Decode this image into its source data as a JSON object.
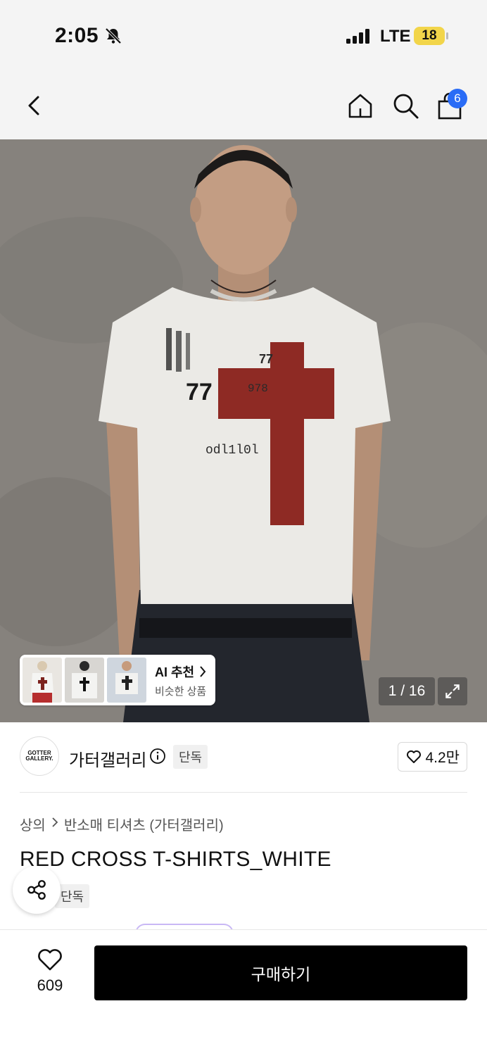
{
  "status_bar": {
    "time": "2:05",
    "network": "LTE",
    "battery": "18"
  },
  "header": {
    "cart_count": "6"
  },
  "gallery": {
    "ai_recommend_title": "AI 추천",
    "ai_recommend_subtitle": "비슷한 상품",
    "page_indicator": "1 / 16"
  },
  "brand": {
    "logo_text_line1": "GOTTER",
    "logo_text_line2": "GALLERY.",
    "name": "가터갤러리",
    "badge": "단독",
    "likes": "4.2만"
  },
  "breadcrumb": {
    "items": [
      "상의",
      "반소매 티셔츠 (가터갤러리)"
    ]
  },
  "product": {
    "title": "RED CROSS T-SHIRTS_WHITE",
    "badge": "단독"
  },
  "bottom_bar": {
    "wish_count": "609",
    "buy_label": "구매하기"
  },
  "colors": {
    "accent_badge": "#2a6cf6",
    "buy_button": "#000000",
    "battery": "#f2d54a",
    "shirt_cross": "#8e2a24"
  },
  "icons": [
    "bell-slash-icon",
    "signal-icon",
    "back-icon",
    "home-icon",
    "search-icon",
    "shopping-bag-icon",
    "expand-icon",
    "info-icon",
    "heart-icon",
    "share-icon",
    "chevron-right-icon"
  ]
}
